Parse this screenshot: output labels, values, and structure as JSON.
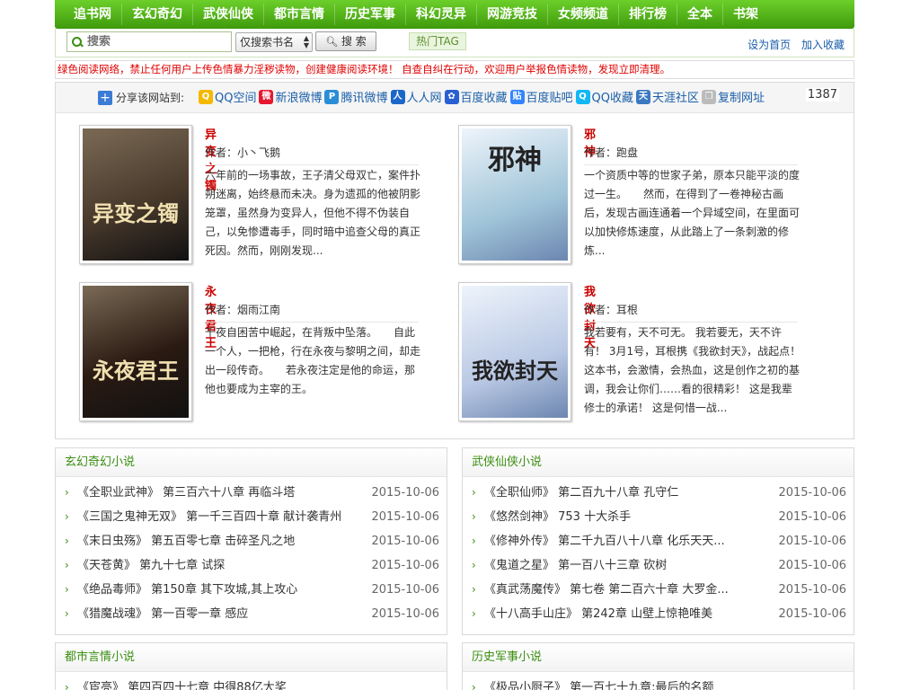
{
  "nav": [
    "追书网",
    "玄幻奇幻",
    "武侠仙侠",
    "都市言情",
    "历史军事",
    "科幻灵异",
    "网游竞技",
    "女频频道",
    "排行榜",
    "全本",
    "书架"
  ],
  "search": {
    "placeholder": "搜索",
    "scope": "仅搜索书名",
    "button": "搜 索",
    "hot_tag": "热门TAG"
  },
  "toplinks": {
    "home": "设为首页",
    "favorite": "加入收藏"
  },
  "warning": "绿色阅读网络，禁止任何用户上传色情暴力淫秽读物，创建健康阅读环境！ 自查自纠在行动，欢迎用户举报色情读物，发现立即清理。",
  "share": {
    "label": "分享该网站到:",
    "links": [
      {
        "label": "QQ空间",
        "icon": "qzone-icon",
        "color": "#f5b800",
        "glyph": "Q"
      },
      {
        "label": "新浪微博",
        "icon": "weibo-icon",
        "color": "#e6162d",
        "glyph": "微"
      },
      {
        "label": "腾讯微博",
        "icon": "tencent-weibo-icon",
        "color": "#2a8ed6",
        "glyph": "P"
      },
      {
        "label": "人人网",
        "icon": "renren-icon",
        "color": "#1b66c9",
        "glyph": "人"
      },
      {
        "label": "百度收藏",
        "icon": "baidu-icon",
        "color": "#2a5fd2",
        "glyph": "✿"
      },
      {
        "label": "百度贴吧",
        "icon": "tieba-icon",
        "color": "#3385ff",
        "glyph": "贴"
      },
      {
        "label": "QQ收藏",
        "icon": "qq-fav-icon",
        "color": "#12b7f5",
        "glyph": "Q"
      },
      {
        "label": "天涯社区",
        "icon": "tianya-icon",
        "color": "#3a78c2",
        "glyph": "天"
      },
      {
        "label": "复制网址",
        "icon": "copy-icon",
        "color": "#bbbbbb",
        "glyph": "❐"
      }
    ],
    "count": "1387"
  },
  "featured": [
    {
      "title": "异变之镯",
      "author": "作者：小丶飞鹅",
      "desc": "六年前的一场事故，王子清父母双亡，案件扑朔迷离，始终悬而未决。身为遗孤的他被阴影笼罩，虽然身为变异人，但他不得不伪装自己，以免惨遭毒手，同时暗中追查父母的真正死因。然而，刚刚发现...",
      "cover_text": "异变之镯",
      "cover_bg": "#4a3a2c"
    },
    {
      "title": "邪神",
      "author": "作者：跑盘",
      "desc": "一个资质中等的世家子弟，原本只能平淡的度过一生。　　然而，在得到了一卷神秘古画后，发现古画连通着一个异域空间，在里面可以加快修炼速度，从此踏上了一条刺激的修炼...",
      "cover_text": "邪神",
      "cover_bg": "#9fc4d8"
    },
    {
      "title": "永夜君王",
      "author": "作者：烟雨江南",
      "desc": "千夜自困苦中崛起，在背叛中坠落。　　自此一个人，一把枪，行在永夜与黎明之间，却走出一段传奇。　　若永夜注定是他的命运，那他也要成为主宰的王。",
      "cover_text": "永夜君王",
      "cover_bg": "#2a1a12"
    },
    {
      "title": "我欲封天",
      "author": "作者：耳根",
      "desc": "我若要有，天不可无。 我若要无，天不许有！ 3月1号，耳根携《我欲封天》，战起点！ 这本书，会激情，会热血，这是创作之初的基调，我会让你们……看的很精彩！ 这是我辈修士的承诺！ 这是何惜一战...",
      "cover_text": "我欲封天",
      "cover_bg": "#b9c8e4"
    }
  ],
  "categories": [
    {
      "name": "玄幻奇幻小说",
      "rows": [
        {
          "title": "《全职业武神》 第三百六十八章 再临斗塔",
          "date": "2015-10-06"
        },
        {
          "title": "《三国之鬼神无双》 第一千三百四十章 献计袭青州",
          "date": "2015-10-06"
        },
        {
          "title": "《末日虫殇》 第五百零七章 击碎圣凡之地",
          "date": "2015-10-06"
        },
        {
          "title": "《天苍黄》 第九十七章 试探",
          "date": "2015-10-06"
        },
        {
          "title": "《绝品毒师》 第150章 其下攻城,其上攻心",
          "date": "2015-10-06"
        },
        {
          "title": "《猎魔战魂》 第一百零一章 感应",
          "date": "2015-10-06"
        }
      ]
    },
    {
      "name": "武侠仙侠小说",
      "rows": [
        {
          "title": "《全职仙师》 第二百九十八章 孔守仁",
          "date": "2015-10-06"
        },
        {
          "title": "《悠然剑神》 753 十大杀手",
          "date": "2015-10-06"
        },
        {
          "title": "《修神外传》 第二千九百八十八章 化乐天天...",
          "date": "2015-10-06"
        },
        {
          "title": "《鬼道之星》 第一百八十三章 砍树",
          "date": "2015-10-06"
        },
        {
          "title": "《真武荡魔传》 第七卷 第二百六十章 大罗金...",
          "date": "2015-10-06"
        },
        {
          "title": "《十八高手山庄》 第242章 山壁上惊艳唯美",
          "date": "2015-10-06"
        }
      ]
    },
    {
      "name": "都市言情小说",
      "rows": [
        {
          "title": "《宦亮》 第四百四十七章 中得88亿大奖",
          "date": ""
        }
      ]
    },
    {
      "name": "历史军事小说",
      "rows": [
        {
          "title": "《极品小厨子》 第一百七十九章:最后的名额",
          "date": ""
        }
      ]
    }
  ]
}
